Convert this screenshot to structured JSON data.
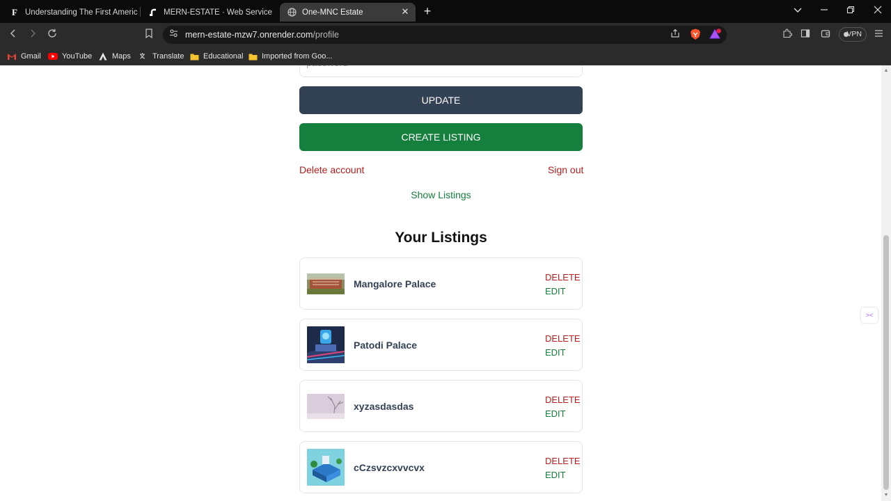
{
  "browser": {
    "tabs": [
      {
        "title": "Understanding The First American Fi",
        "favicon": "letter-F-icon"
      },
      {
        "title": "MERN-ESTATE · Web Service · Rend",
        "favicon": "render-icon"
      },
      {
        "title": "One-MNC Estate",
        "favicon": "globe-icon",
        "active": true
      }
    ],
    "url_host": "mern-estate-mzw7.onrender.com",
    "url_path": "/profile",
    "vpn_label": "VPN",
    "brave_badge": "1",
    "bookmarks": [
      {
        "label": "Gmail",
        "icon": "gmail-icon"
      },
      {
        "label": "YouTube",
        "icon": "youtube-icon"
      },
      {
        "label": "Maps",
        "icon": "maps-icon"
      },
      {
        "label": "Translate",
        "icon": "translate-icon"
      },
      {
        "label": "Educational",
        "icon": "folder-icon"
      },
      {
        "label": "Imported from Goo...",
        "icon": "folder-icon"
      }
    ]
  },
  "profile": {
    "password_placeholder": "password",
    "update_label": "UPDATE",
    "create_listing_label": "CREATE LISTING",
    "delete_account_label": "Delete account",
    "sign_out_label": "Sign out",
    "show_listings_label": "Show Listings",
    "your_listings_heading": "Your Listings",
    "listings": [
      {
        "name": "Mangalore Palace",
        "delete_label": "DELETE",
        "edit_label": "EDIT",
        "thumb": "palace-photo"
      },
      {
        "name": "Patodi Palace",
        "delete_label": "DELETE",
        "edit_label": "EDIT",
        "thumb": "tech-building-art"
      },
      {
        "name": "xyzasdasdas",
        "delete_label": "DELETE",
        "edit_label": "EDIT",
        "thumb": "winter-tree-photo"
      },
      {
        "name": "cCzsvzcxvvcvx",
        "delete_label": "DELETE",
        "edit_label": "EDIT",
        "thumb": "isometric-building-art"
      }
    ]
  },
  "colors": {
    "update_bg": "#334155",
    "create_bg": "#15803d",
    "danger": "#b91c1c",
    "success": "#15803d"
  }
}
